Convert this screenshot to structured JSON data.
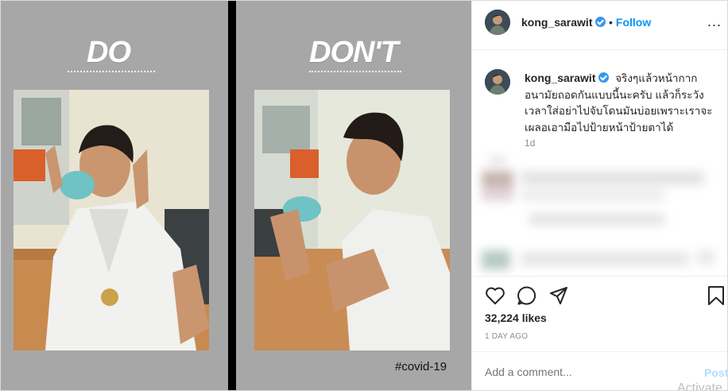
{
  "post": {
    "left_heading": "DO",
    "right_heading": "DON'T",
    "hashtag": "#covid-19"
  },
  "header": {
    "username": "kong_sarawit",
    "follow_separator": "•",
    "follow_label": "Follow",
    "more_label": "..."
  },
  "caption": {
    "username": "kong_sarawit",
    "text": "จริงๆแล้วหน้ากากอนามัยถอดกันแบบนี้นะครับ แล้วก็ระวังเวลาใส่อย่าไปจับโดนมันบ่อยเพราะเราจะเผลอเอามือไปป้ายหน้าป้ายตาได้",
    "time": "1d"
  },
  "actions": {
    "likes": "32,224 likes",
    "ago": "1 DAY AGO",
    "comment_placeholder": "Add a comment...",
    "post_label": "Post"
  },
  "overlay": {
    "watermark": "Activate"
  },
  "icons": [
    "heart-icon",
    "comment-icon",
    "share-icon",
    "bookmark-icon",
    "verified-icon",
    "more-icon"
  ],
  "colors": {
    "link": "#0095f6",
    "verified": "#3897f0",
    "post_disabled": "#b2dffc",
    "panel_gray": "#a7a7a7"
  }
}
